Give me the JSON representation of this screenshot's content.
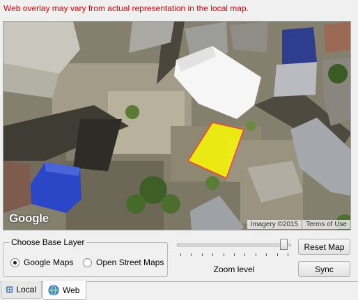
{
  "warning": "Web overlay may vary from actual representation in the local map.",
  "map": {
    "logo": "Google",
    "imagery_credit": "Imagery ©2015",
    "terms_link": "Terms of Use",
    "colors": {
      "highlight_fill": "#ffff00",
      "highlight_stroke": "#ff3b3b"
    }
  },
  "base_layer": {
    "title": "Choose Base Layer",
    "options": [
      {
        "label": "Google Maps",
        "selected": true
      },
      {
        "label": "Open Street Maps",
        "selected": false
      }
    ]
  },
  "zoom": {
    "label": "Zoom level",
    "level_fraction": 0.97
  },
  "buttons": {
    "reset_map": "Reset Map",
    "sync": "Sync"
  },
  "tabs": [
    {
      "label": "Local",
      "icon": "grid-map-icon",
      "active": false
    },
    {
      "label": "Web",
      "icon": "globe-icon",
      "active": true
    }
  ]
}
